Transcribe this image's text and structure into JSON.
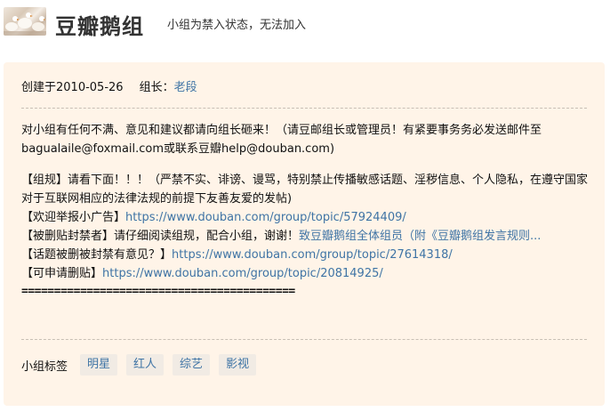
{
  "header": {
    "group_name": "豆瓣鹅组",
    "status": "小组为禁入状态，无法加入"
  },
  "meta": {
    "created_label": "创建于2010-05-26",
    "leader_label": "组长：",
    "leader_name": "老段"
  },
  "intro": {
    "line1_text": "对小组有任何不满、意见和建议都请向组长砸来！（请豆邮组长或管理员！有紧要事务务必发送邮件至bagualaile@foxmail.com或联系豆瓣help@douban.com)",
    "rules_text": "【组规】请看下面！！！（严禁不实、诽谤、谩骂，特别禁止传播敏感话题、淫秽信息、个人隐私，在遵守国家对于互联网相应的法律法规的前提下友善友爱的发帖)",
    "ad_label": "【欢迎举报小广告】",
    "ad_link": "https://www.douban.com/group/topic/57924409/",
    "banned_label": "【被删贴封禁者】请仔细阅读组规，配合小组，谢谢！",
    "banned_link": "致豆瓣鹅组全体组员（附《豆瓣鹅组发言规则...",
    "topic_label": "【话题被删被封禁有意见？】",
    "topic_link": "https://www.douban.com/group/topic/27614318/",
    "apply_label": "【可申请删贴】",
    "apply_link": "https://www.douban.com/group/topic/20814925/",
    "equals_line": "=========================================="
  },
  "tags": {
    "label": "小组标签",
    "items": [
      "明星",
      "红人",
      "综艺",
      "影视"
    ]
  }
}
